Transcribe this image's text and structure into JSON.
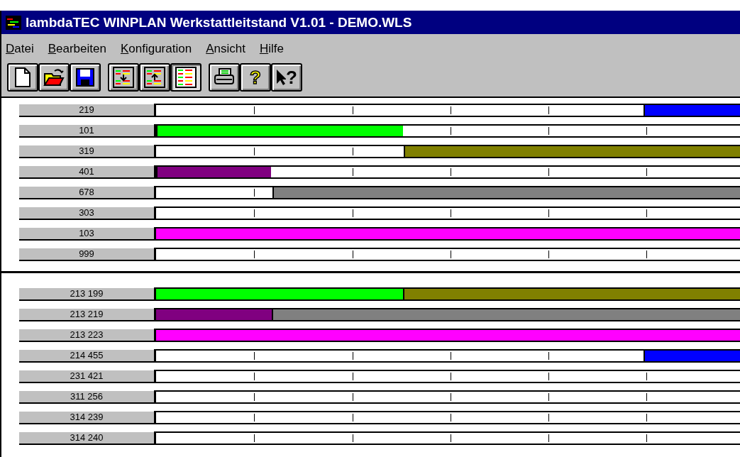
{
  "window": {
    "title": "lambdaTEC WINPLAN Werkstattleitstand V1.01 - DEMO.WLS"
  },
  "menu": [
    {
      "label": "Datei"
    },
    {
      "label": "Bearbeiten"
    },
    {
      "label": "Konfiguration"
    },
    {
      "label": "Ansicht"
    },
    {
      "label": "Hilfe"
    }
  ],
  "toolbar": [
    {
      "kind": "new"
    },
    {
      "kind": "open"
    },
    {
      "kind": "save"
    },
    {
      "kind": "gap"
    },
    {
      "kind": "expand"
    },
    {
      "kind": "collapse"
    },
    {
      "kind": "plan",
      "selected": true
    },
    {
      "kind": "gap"
    },
    {
      "kind": "print"
    },
    {
      "kind": "help",
      "label": "?"
    },
    {
      "kind": "context-help",
      "label": "?"
    }
  ],
  "panels": [
    {
      "rows": [
        {
          "label": "219",
          "segments": [
            {
              "kind": "gap",
              "level": 0.835
            },
            {
              "kind": "bar",
              "level": 0.165,
              "color": "#0000ff"
            }
          ]
        },
        {
          "label": "101",
          "segments": [
            {
              "kind": "bar",
              "level": 0.423,
              "color": "#00ff00"
            },
            {
              "kind": "gap",
              "level": 0.577
            }
          ]
        },
        {
          "label": "319",
          "segments": [
            {
              "kind": "gap",
              "level": 0.424
            },
            {
              "kind": "bar",
              "level": 0.576,
              "color": "#808000"
            }
          ]
        },
        {
          "label": "401",
          "segments": [
            {
              "kind": "bar",
              "level": 0.197,
              "color": "#800080"
            },
            {
              "kind": "gap",
              "level": 0.803
            }
          ]
        },
        {
          "label": "678",
          "segments": [
            {
              "kind": "gap",
              "level": 0.199
            },
            {
              "kind": "bar",
              "level": 0.801,
              "color": "#808080"
            }
          ]
        },
        {
          "label": "303",
          "segments": [
            {
              "kind": "gap",
              "level": 1
            }
          ]
        },
        {
          "label": "103",
          "segments": [
            {
              "kind": "bar",
              "level": 1,
              "color": "#ff00ff"
            }
          ]
        },
        {
          "label": "999",
          "segments": [
            {
              "kind": "gap",
              "level": 1
            }
          ]
        }
      ]
    },
    {
      "rows": [
        {
          "label": "213 199",
          "segments": [
            {
              "kind": "bar",
              "level": 0.423,
              "color": "#00ff00"
            },
            {
              "kind": "bar",
              "level": 0.577,
              "color": "#808000"
            }
          ]
        },
        {
          "label": "213 219",
          "segments": [
            {
              "kind": "bar",
              "level": 0.198,
              "color": "#800080"
            },
            {
              "kind": "bar",
              "level": 0.802,
              "color": "#808080"
            }
          ]
        },
        {
          "label": "213 223",
          "segments": [
            {
              "kind": "bar",
              "level": 1,
              "color": "#ff00ff"
            }
          ]
        },
        {
          "label": "214 455",
          "segments": [
            {
              "kind": "gap",
              "level": 0.835
            },
            {
              "kind": "bar",
              "level": 0.165,
              "color": "#0000ff"
            }
          ]
        },
        {
          "label": "231 421",
          "segments": [
            {
              "kind": "gap",
              "level": 1
            }
          ]
        },
        {
          "label": "311 256",
          "segments": [
            {
              "kind": "gap",
              "level": 1
            }
          ]
        },
        {
          "label": "314 239",
          "segments": [
            {
              "kind": "gap",
              "level": 1
            }
          ]
        },
        {
          "label": "314 240",
          "segments": [
            {
              "kind": "gap",
              "level": 1
            }
          ]
        }
      ]
    }
  ]
}
